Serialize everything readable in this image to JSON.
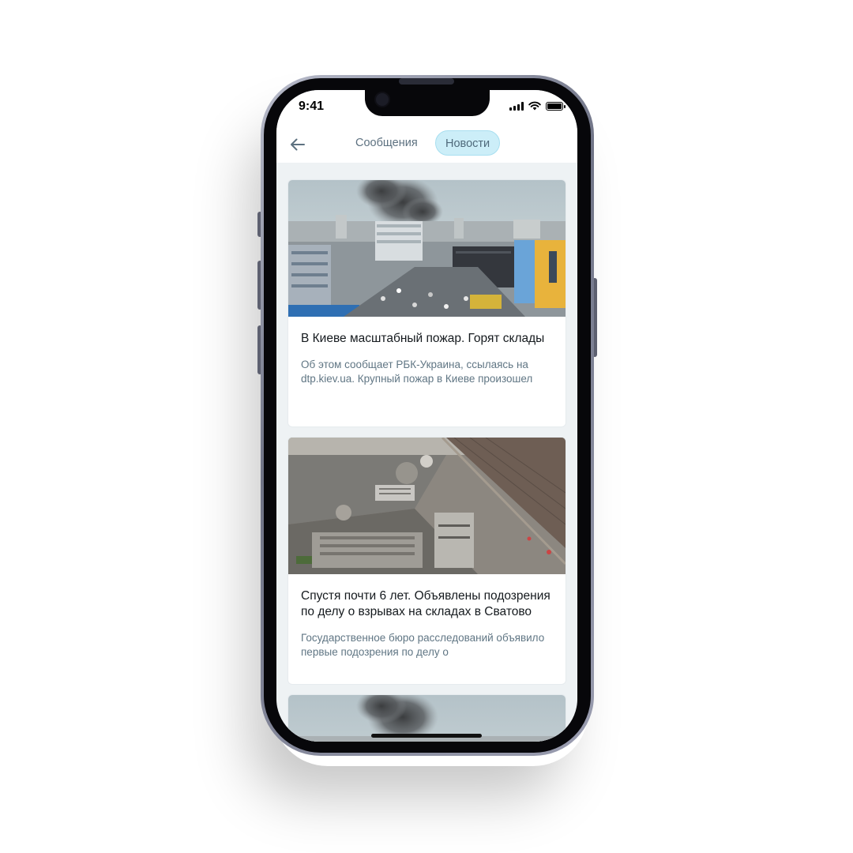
{
  "status_bar": {
    "time": "9:41"
  },
  "header": {
    "back_icon": "arrow-left-icon",
    "tabs": [
      {
        "label": "Сообщения",
        "active": false
      },
      {
        "label": "Новости",
        "active": true
      }
    ]
  },
  "feed": {
    "items": [
      {
        "image": "city-fire-smoke-photo",
        "title": "В Киеве масштабный пожар. Горят склады",
        "description": "Об этом сообщает РБК-Украина, ссылаясь на dtp.kiev.ua. Крупный пожар в Киеве произошел"
      },
      {
        "image": "destroyed-warehouses-aerial-photo",
        "title": "Спустя почти 6 лет. Объявлены подозрения по делу о взрывах на складах в Сватово",
        "description": "Государственное бюро расследований объявило первые подозрения по делу о"
      },
      {
        "image": "city-fire-smoke-photo"
      }
    ]
  },
  "colors": {
    "active_tab_bg": "#cceef8",
    "feed_bg": "#eef2f4",
    "title_text": "#151a1e",
    "desc_text": "#607684"
  }
}
